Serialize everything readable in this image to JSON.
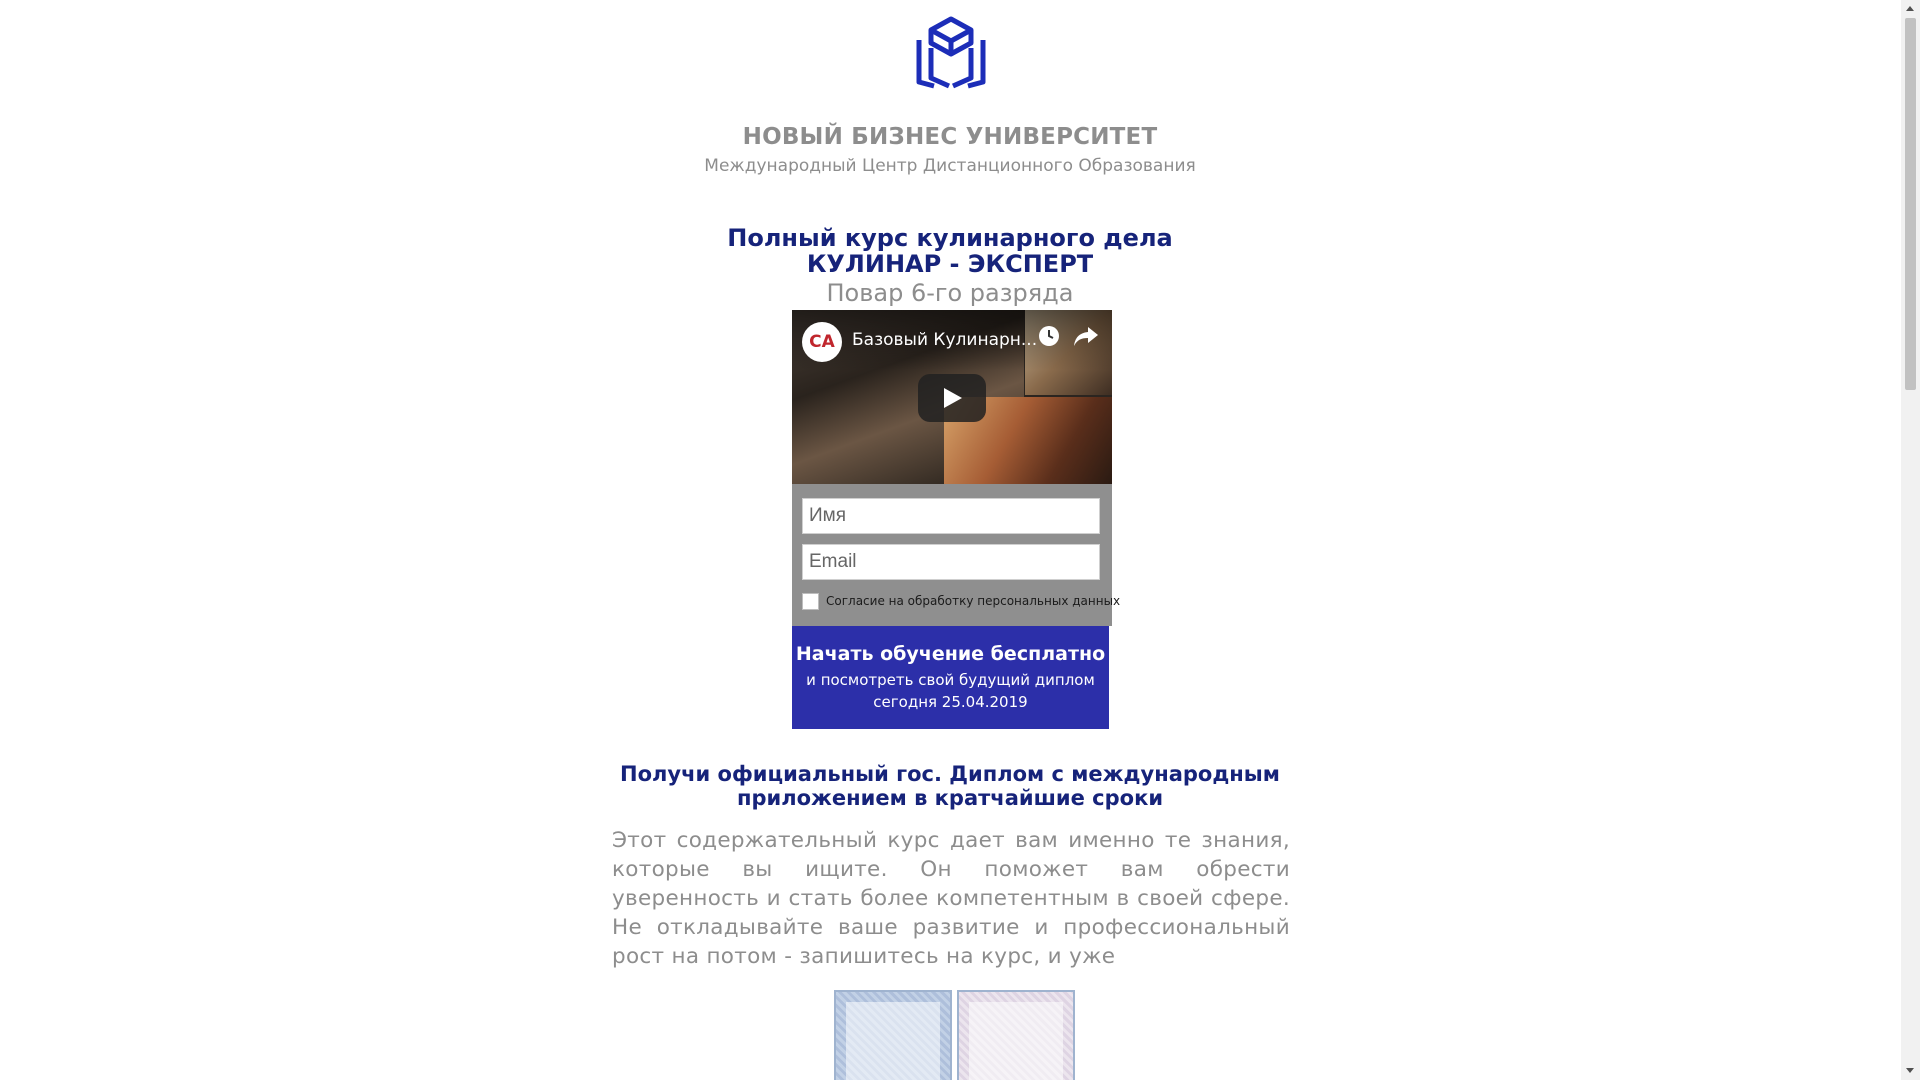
{
  "brand": {
    "logo_icon": "university-book-cap-logo",
    "name": "НОВЫЙ БИЗНЕС УНИВЕРСИТЕТ",
    "subtitle": "Международный Центр Дистанционного Образования"
  },
  "course": {
    "line1": "Полный курс кулинарного дела",
    "line2": "КУЛИНАР - ЭКСПЕРТ",
    "rank": "Повар 6-го разряда"
  },
  "video": {
    "channel_avatar": "СА",
    "title": "Базовый Кулинарн...",
    "icons": [
      "clock-icon",
      "share-icon",
      "play-icon"
    ]
  },
  "form": {
    "name_placeholder": "Имя",
    "email_placeholder": "Email",
    "consent_label": "Согласие на обработку персональных данных"
  },
  "cta": {
    "main": "Начать обучение бесплатно",
    "sub1": "и посмотреть свой будущий диплом",
    "sub2": "сегодня 25.04.2019"
  },
  "diploma": {
    "heading1": "Получи официальный гос. Диплом с международным",
    "heading2": "приложением в кратчайшие сроки",
    "body": "Этот содержательный курс дает вам именно те знания, которые вы ищите. Он поможет вам обрести уверенность и стать более компетентным в своей сфере. Не откладывайте ваше развитие и профессиональный рост на потом - запишитесь на курс, и уже"
  },
  "colors": {
    "accent_navy": "#16237a",
    "gray_text": "#8d8d8d",
    "cta_blue": "#2c2fa9",
    "form_gray": "#8f8f8f",
    "logo_blue": "#1c2db8"
  }
}
